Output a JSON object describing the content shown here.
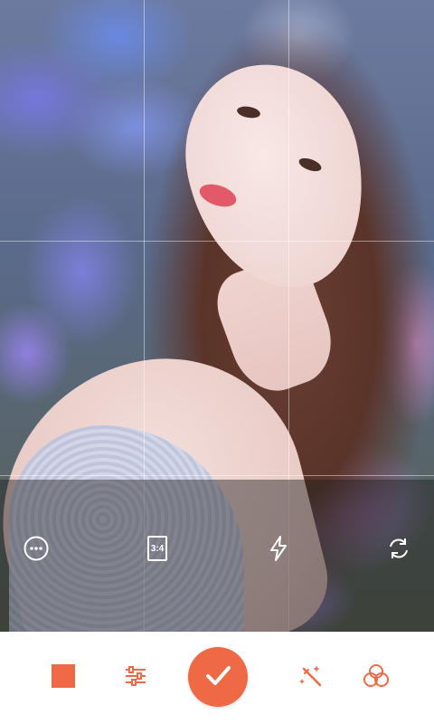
{
  "camera": {
    "aspect_ratio_label": "3:4",
    "grid_enabled": true
  },
  "icons": {
    "more": "more-options-icon",
    "ratio": "aspect-ratio-icon",
    "flash": "flash-icon",
    "switch_camera": "switch-camera-icon",
    "mode": "square-mode-icon",
    "adjust": "sliders-icon",
    "capture": "checkmark-icon",
    "magic": "magic-wand-icon",
    "filters": "filters-icon"
  },
  "colors": {
    "accent": "#ef6a44",
    "overlay_icon": "#ffffff",
    "toolbar_background": "#ffffff"
  }
}
